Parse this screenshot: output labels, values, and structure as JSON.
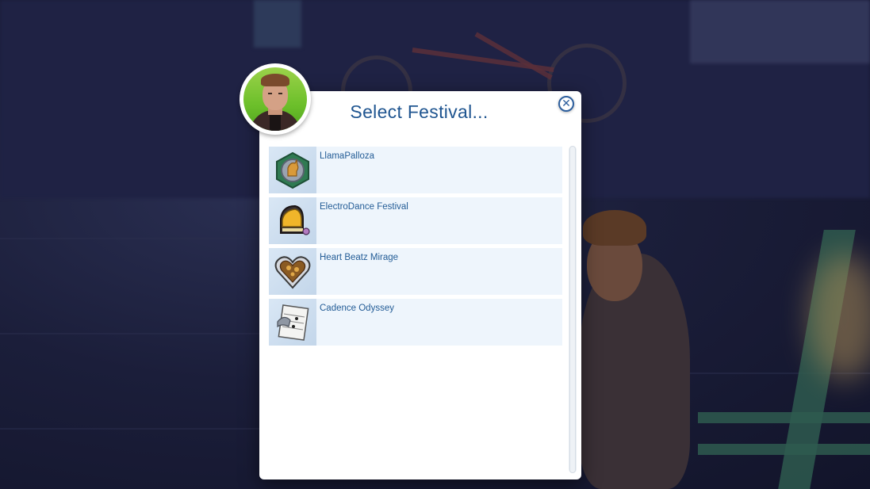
{
  "dialog": {
    "title": "Select Festival...",
    "close_symbol": "✕",
    "avatar_icon": "sim-portrait-icon"
  },
  "festivals": [
    {
      "label": "LlamaPalloza",
      "icon": "llama-badge-icon"
    },
    {
      "label": "ElectroDance Festival",
      "icon": "dj-helmet-icon"
    },
    {
      "label": "Heart Beatz Mirage",
      "icon": "heart-icon"
    },
    {
      "label": "Cadence Odyssey",
      "icon": "sheet-music-icon"
    }
  ],
  "colors": {
    "accent": "#1f5590",
    "row_bg": "#eef5fc",
    "avatar_bg": "#6cbf2a"
  }
}
